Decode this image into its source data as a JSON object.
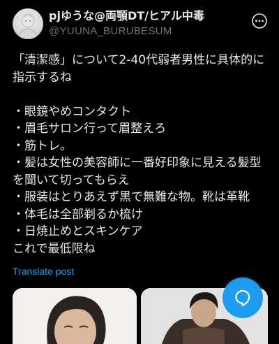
{
  "author": {
    "display_name": "pjゆうな@両顎DT/ヒアル中毒",
    "handle": "@YUUNA_BURUBESUM"
  },
  "tweet": {
    "text": "「清潔感」について2-40代弱者男性に具体的に\n指示するね\n\n・眼鏡やめコンタクト\n・眉毛サロン行って眉整えろ\n・筋トレ。\n・髪は女性の美容師に一番好印象に見える髪型\nを聞いて切ってもらえ\n・服装はとりあえず黒で無難な物。靴は革靴\n・体毛は全部剃るか梳け\n・日焼止めとスキンケア\nこれで最低限ね",
    "translate_label": "Translate post"
  },
  "icons": {
    "more": "more-icon",
    "compose": "compose-reply-icon"
  },
  "colors": {
    "background": "#000000",
    "text": "#e7e9ea",
    "secondary": "#71767b",
    "accent": "#1d9bf0"
  }
}
